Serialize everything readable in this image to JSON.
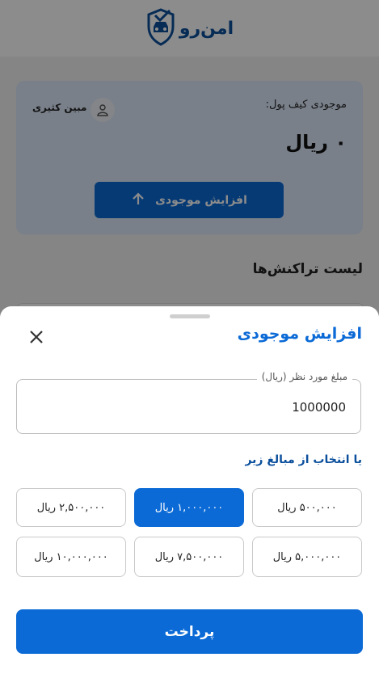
{
  "header": {
    "logo_text": "امن‌رو",
    "logo_icon": "shield-car-icon"
  },
  "wallet": {
    "balance_label": "موجودی کیف پول:",
    "user_name": "مبین کثیری",
    "balance_value": "۰ ریال",
    "increase_button_label": "افزایش موجودی"
  },
  "transactions": {
    "title": "لیست تراکنش‌ها"
  },
  "sheet": {
    "title": "افزایش موجودی",
    "amount_field": {
      "label": "مبلغ مورد نظر (ریال)",
      "value": "1000000"
    },
    "preset_title": "یا انتخاب از مبالغ زیر",
    "presets": [
      {
        "label": "۵۰۰,۰۰۰ ریال"
      },
      {
        "label": "۱,۰۰۰,۰۰۰ ریال"
      },
      {
        "label": "۲,۵۰۰,۰۰۰ ریال"
      },
      {
        "label": "۵,۰۰۰,۰۰۰ ریال"
      },
      {
        "label": "۷,۵۰۰,۰۰۰ ریال"
      },
      {
        "label": "۱۰,۰۰۰,۰۰۰ ریال"
      }
    ],
    "selected_preset": "۱,۰۰۰,۰۰۰ ریال",
    "pay_button_label": "پرداخت"
  },
  "colors": {
    "accent": "#0b6ad6",
    "brand": "#0b4f9c",
    "overlay": "rgba(0,0,0,0.45)"
  }
}
